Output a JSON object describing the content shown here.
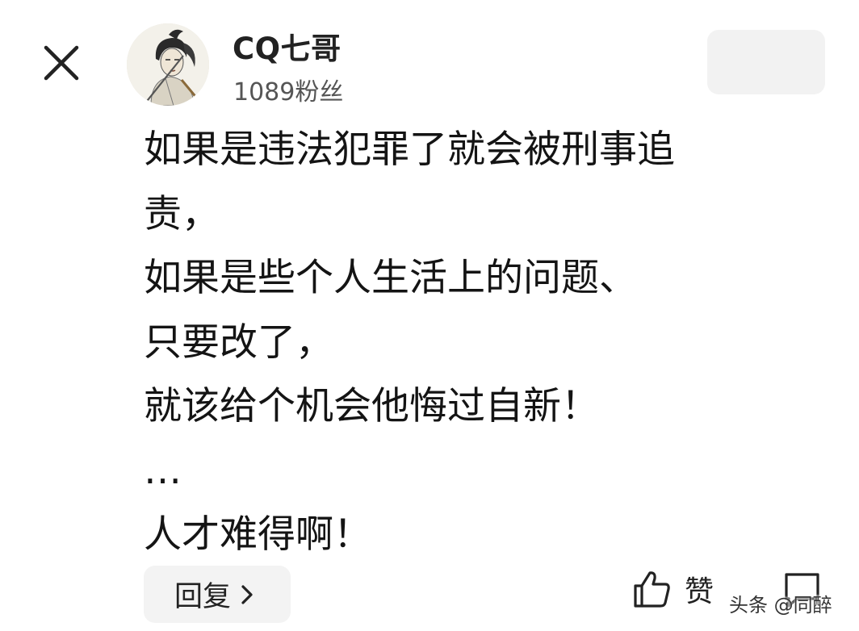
{
  "post": {
    "author": {
      "name": "CQ七哥",
      "followers": "1089粉丝"
    },
    "comment_lines": [
      "如果是违法犯罪了就会被刑事追",
      "责，",
      "如果是些个人生活上的问题、",
      "只要改了，",
      "就该给个机会他悔过自新！",
      "…",
      "人才难得啊！"
    ]
  },
  "actions": {
    "reply_label": "回复",
    "like_label": "赞"
  },
  "watermark": "头条 @同醉",
  "icons": {
    "close": "close-icon",
    "reply_chevron": "chevron-right-icon",
    "like": "thumbs-up-icon",
    "more": "comment-icon"
  },
  "colors": {
    "text": "#141414",
    "secondary_text": "#555555",
    "button_bg": "#f3f3f3"
  }
}
